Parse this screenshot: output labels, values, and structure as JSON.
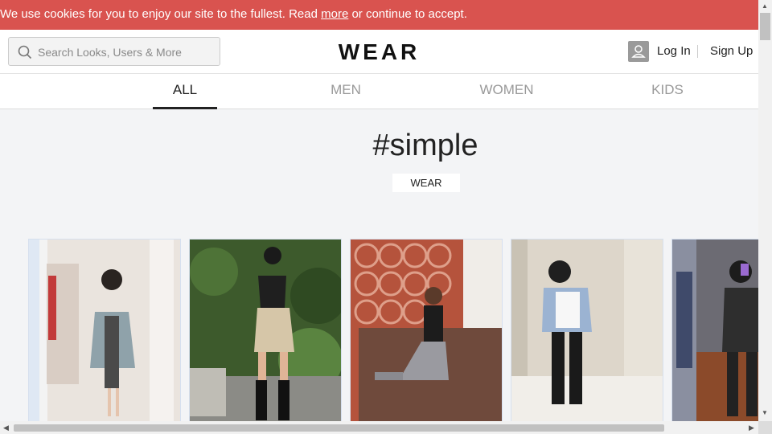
{
  "cookie": {
    "text_before": "We use cookies for you to enjoy our site to the fullest. Read ",
    "link": "more",
    "text_after": " or continue to accept."
  },
  "header": {
    "search_placeholder": "Search Looks, Users & More",
    "logo": "WEAR",
    "login": "Log In",
    "signup": "Sign Up"
  },
  "tabs": [
    "ALL",
    "MEN",
    "WOMEN",
    "KIDS"
  ],
  "active_tab": "ALL",
  "page": {
    "title": "#simple",
    "badge": "WEAR"
  },
  "looks": [
    {
      "name": "look-1",
      "bg": "#ece6df",
      "accent": "#7f9aa6"
    },
    {
      "name": "look-2",
      "bg": "#3f5a2f",
      "accent": "#d8c8ad"
    },
    {
      "name": "look-3",
      "bg": "#b8553f",
      "accent": "#6b4a3a"
    },
    {
      "name": "look-4",
      "bg": "#d9d3c8",
      "accent": "#eeeeee"
    },
    {
      "name": "look-5",
      "bg": "#6a6a75",
      "accent": "#303030"
    }
  ],
  "colors": {
    "cookie_bar": "#d9534f",
    "text": "#222222",
    "muted": "#999999"
  }
}
